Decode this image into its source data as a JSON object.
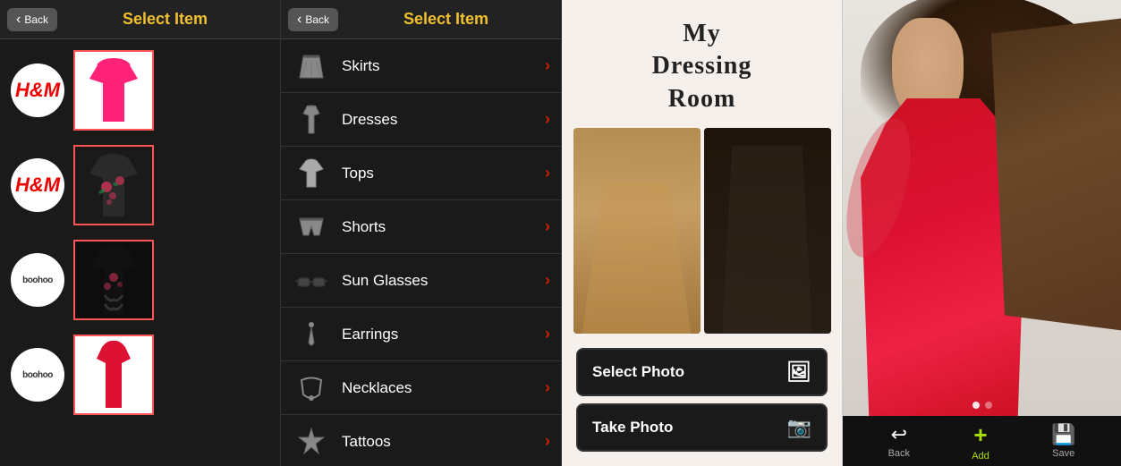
{
  "panel1": {
    "header": {
      "back_label": "Back",
      "title": "Select Item"
    },
    "items": [
      {
        "brand": "H&M",
        "brand_type": "hm",
        "has_image": true,
        "image_type": "pink-top"
      },
      {
        "brand": "H&M",
        "brand_type": "hm",
        "has_image": true,
        "image_type": "floral-top"
      },
      {
        "brand": "boohoo",
        "brand_type": "boohoo",
        "has_image": true,
        "image_type": "black-floral"
      },
      {
        "brand": "boohoo",
        "brand_type": "boohoo",
        "has_image": true,
        "image_type": "red-top"
      }
    ]
  },
  "panel2": {
    "header": {
      "back_label": "Back",
      "title": "Select Item"
    },
    "categories": [
      {
        "id": "skirts",
        "label": "Skirts"
      },
      {
        "id": "dresses",
        "label": "Dresses"
      },
      {
        "id": "tops",
        "label": "Tops"
      },
      {
        "id": "shorts",
        "label": "Shorts"
      },
      {
        "id": "sunglasses",
        "label": "Sun Glasses"
      },
      {
        "id": "earrings",
        "label": "Earrings"
      },
      {
        "id": "necklaces",
        "label": "Necklaces"
      },
      {
        "id": "tattoos",
        "label": "Tattoos"
      }
    ],
    "chevron": "›"
  },
  "panel3": {
    "title_line1": "My",
    "title_line2": "Dressing",
    "title_line3": "Room",
    "buttons": [
      {
        "id": "select-photo",
        "label": "Select Photo",
        "icon": "🖼"
      },
      {
        "id": "take-photo",
        "label": "Take Photo",
        "icon": "📷"
      }
    ]
  },
  "panel4": {
    "toolbar": [
      {
        "id": "back",
        "label": "Back",
        "icon": "↩"
      },
      {
        "id": "add",
        "label": "Add",
        "icon": "+"
      },
      {
        "id": "save",
        "label": "Save",
        "icon": "💾"
      }
    ]
  }
}
